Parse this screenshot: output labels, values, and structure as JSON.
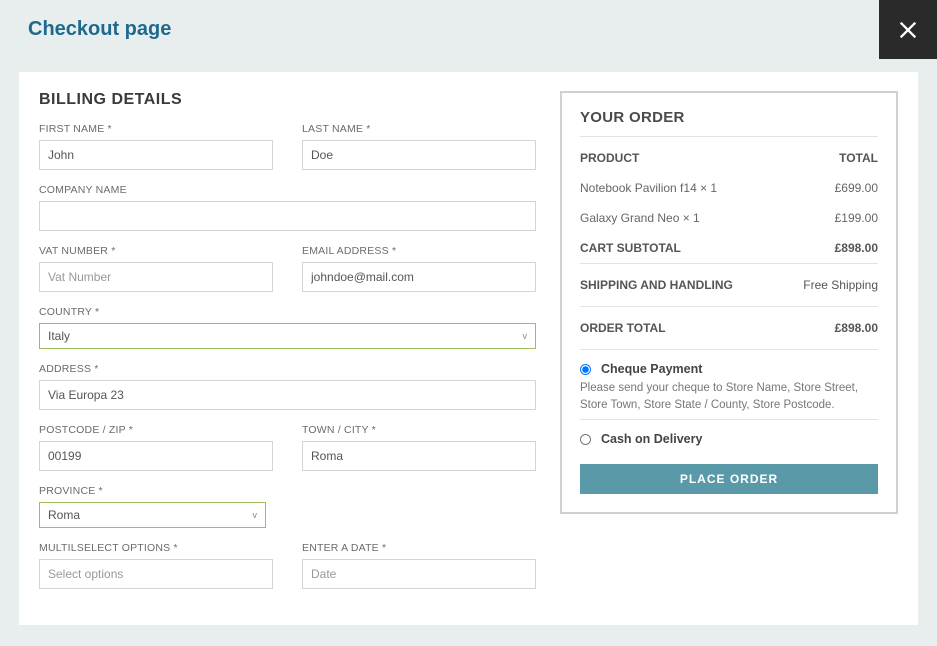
{
  "page_title": "Checkout page",
  "billing": {
    "heading": "BILLING DETAILS",
    "first_name": {
      "label": "FIRST NAME *",
      "value": "John"
    },
    "last_name": {
      "label": "LAST NAME *",
      "value": "Doe"
    },
    "company": {
      "label": "COMPANY NAME",
      "value": ""
    },
    "vat": {
      "label": "VAT NUMBER *",
      "value": "",
      "placeholder": "Vat Number"
    },
    "email": {
      "label": "EMAIL ADDRESS *",
      "value": "johndoe@mail.com"
    },
    "country": {
      "label": "COUNTRY *",
      "value": "Italy"
    },
    "address": {
      "label": "ADDRESS *",
      "value": "Via Europa 23"
    },
    "postcode": {
      "label": "POSTCODE / ZIP *",
      "value": "00199"
    },
    "town": {
      "label": "TOWN / CITY *",
      "value": "Roma"
    },
    "province": {
      "label": "PROVINCE *",
      "value": "Roma"
    },
    "multiselect": {
      "label": "MULTILSELECT OPTIONS *",
      "value": "",
      "placeholder": "Select options"
    },
    "date": {
      "label": "ENTER A DATE *",
      "value": "",
      "placeholder": "Date"
    }
  },
  "order": {
    "heading": "YOUR ORDER",
    "head_product": "PRODUCT",
    "head_total": "TOTAL",
    "items": [
      {
        "name": "Notebook Pavilion f14 × 1",
        "price": "£699.00"
      },
      {
        "name": "Galaxy Grand Neo × 1",
        "price": "£199.00"
      }
    ],
    "subtotal_label": "CART SUBTOTAL",
    "subtotal_value": "£898.00",
    "shipping_label": "SHIPPING AND HANDLING",
    "shipping_value": "Free Shipping",
    "total_label": "ORDER TOTAL",
    "total_value": "£898.00",
    "payment_cheque": {
      "label": "Cheque Payment",
      "desc": "Please send your cheque to Store Name, Store Street, Store Town, Store State / County, Store Postcode."
    },
    "payment_cod": {
      "label": "Cash on Delivery"
    },
    "place_order": "PLACE ORDER"
  }
}
